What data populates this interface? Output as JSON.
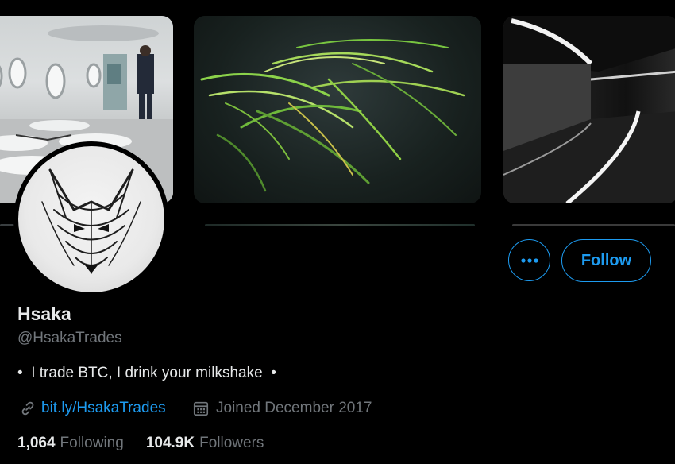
{
  "profile": {
    "name": "Hsaka",
    "handle": "@HsakaTrades",
    "bio": "•  I trade BTC, I drink your milkshake  •",
    "link": "bit.ly/HsakaTrades",
    "joined": "Joined December 2017"
  },
  "actions": {
    "more_icon": "more-icon",
    "follow_label": "Follow"
  },
  "stats": {
    "following_count": "1,064",
    "following_label": "Following",
    "followers_count": "104.9K",
    "followers_label": "Followers"
  },
  "colors": {
    "accent": "#1d9bf0",
    "background": "#000000",
    "muted_text": "#71767b",
    "primary_text": "#e7e9ea"
  }
}
